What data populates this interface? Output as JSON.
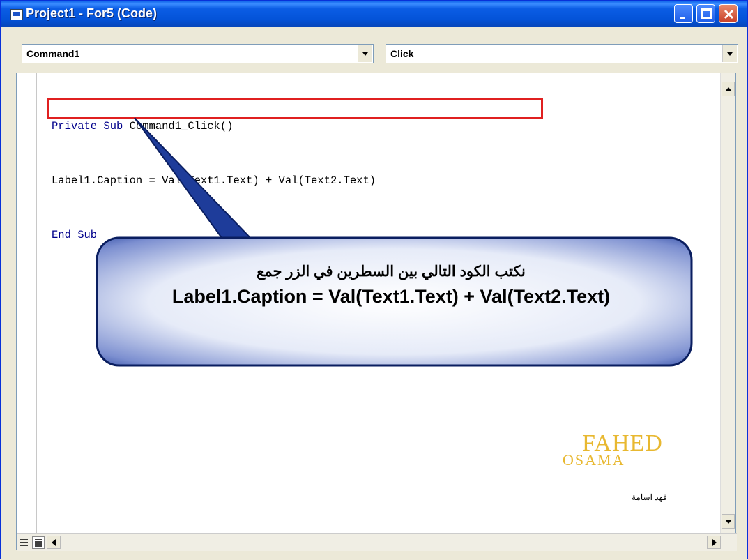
{
  "window": {
    "title": "Project1 - For5 (Code)"
  },
  "object_combo": {
    "value": "Command1"
  },
  "procedure_combo": {
    "value": "Click"
  },
  "code": {
    "line1_kw": "Private Sub",
    "line1_rest": " Command1_Click()",
    "line2": "Label1.Caption = Val(Text1.Text) + Val(Text2.Text)",
    "line3": "End Sub"
  },
  "callout": {
    "arabic": "نكتب الكود التالي بين السطرين في الزر جمع",
    "code": "Label1.Caption = Val(Text1.Text) + Val(Text2.Text)"
  },
  "watermark": {
    "line1": "FAHED",
    "line2": "OSAMA",
    "caption": "فهد اسامة"
  },
  "colors": {
    "highlight_box": "#E02020",
    "callout_fill": "#1E3C9A",
    "watermark": "#E8B830"
  }
}
